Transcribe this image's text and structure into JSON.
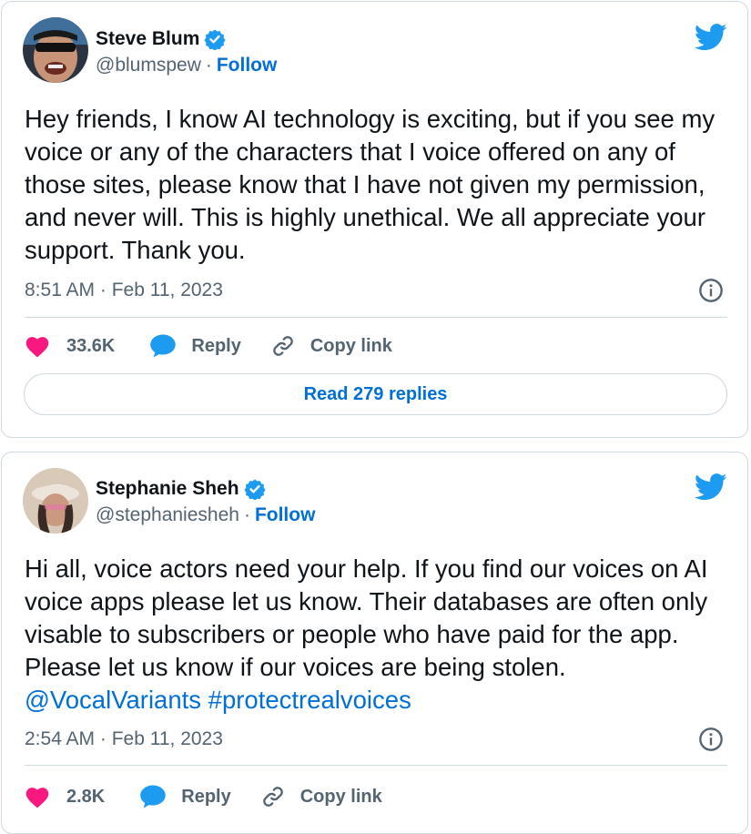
{
  "tweets": [
    {
      "author": {
        "name": "Steve Blum",
        "handle": "@blumspew",
        "verified": true,
        "follow_label": "Follow",
        "avatar": "angry-face-avatar"
      },
      "text": "Hey friends, I know AI technology is exciting, but if you see my voice or any of the characters that I voice offered on any of those sites, please know that I have not given my permission, and never will. This is highly unethical. We all appreciate your support. Thank you.",
      "timestamp": "8:51 AM · Feb 11, 2023",
      "likes": "33.6K",
      "reply_label": "Reply",
      "copy_link_label": "Copy link",
      "read_replies_label": "Read 279 replies"
    },
    {
      "author": {
        "name": "Stephanie Sheh",
        "handle": "@stephaniesheh",
        "verified": true,
        "follow_label": "Follow",
        "avatar": "hat-person-avatar"
      },
      "text_plain": "Hi all, voice actors need your help. If you find our voices on AI voice apps please let us know. Their databases are often only visable to subscribers or people who have paid for the app. Please let us know if our voices are being stolen. ",
      "mention": "@VocalVariants",
      "hashtag": "#protectrealvoices",
      "timestamp": "2:54 AM · Feb 11, 2023",
      "likes": "2.8K",
      "reply_label": "Reply",
      "copy_link_label": "Copy link"
    }
  ],
  "icons": {
    "brand": "twitter-bird-icon",
    "verified": "verified-badge-icon",
    "info": "info-icon",
    "like": "heart-icon",
    "reply": "speech-bubble-icon",
    "copy_link": "link-icon"
  },
  "colors": {
    "twitter_blue": "#1d9bf0",
    "link_blue": "#006fd6",
    "heart_red": "#f91880",
    "secondary_text": "#536471",
    "border": "#cfd9de"
  }
}
